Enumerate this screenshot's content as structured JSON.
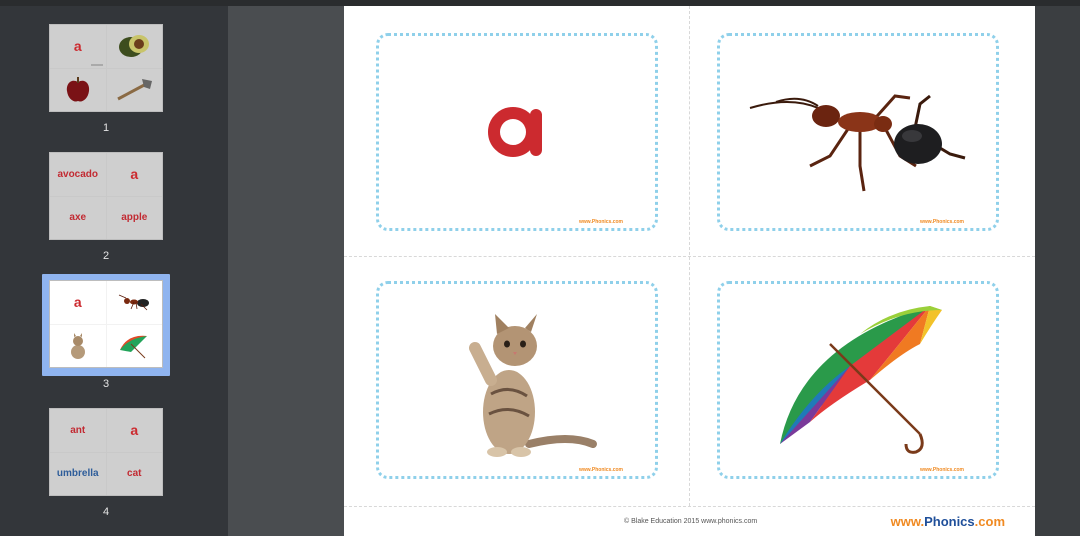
{
  "thumbnails": [
    {
      "number": "1",
      "cells": [
        {
          "kind": "letter",
          "text": "a"
        },
        {
          "kind": "icon",
          "text": "avocado"
        },
        {
          "kind": "icon",
          "text": "apple"
        },
        {
          "kind": "icon",
          "text": "axe"
        }
      ]
    },
    {
      "number": "2",
      "cells": [
        {
          "kind": "word",
          "text": "avocado"
        },
        {
          "kind": "letter",
          "text": "a"
        },
        {
          "kind": "word",
          "text": "axe"
        },
        {
          "kind": "word",
          "text": "apple"
        }
      ]
    },
    {
      "number": "3",
      "selected": true,
      "cells": [
        {
          "kind": "letter",
          "text": "a"
        },
        {
          "kind": "icon",
          "text": "ant"
        },
        {
          "kind": "icon",
          "text": "cat"
        },
        {
          "kind": "icon",
          "text": "umbrella"
        }
      ]
    },
    {
      "number": "4",
      "cells": [
        {
          "kind": "word",
          "text": "ant"
        },
        {
          "kind": "letter",
          "text": "a"
        },
        {
          "kind": "word",
          "text": "umbrella"
        },
        {
          "kind": "word",
          "text": "cat"
        }
      ]
    }
  ],
  "page": {
    "cards": [
      {
        "id": "letter-a",
        "letter": "a",
        "footer": "www.Phonics.com"
      },
      {
        "id": "ant",
        "image": "ant",
        "footer": "www.Phonics.com"
      },
      {
        "id": "cat",
        "image": "kitten",
        "footer": "www.Phonics.com"
      },
      {
        "id": "umbrella",
        "image": "umbrella",
        "footer": "www.Phonics.com"
      }
    ],
    "copyright": "© Blake Education 2015  www.phonics.com",
    "brand_prefix": "www.",
    "brand_main": "Phonics",
    "brand_suffix": ".com"
  },
  "colors": {
    "letter_red": "#cc2a2f",
    "brand_orange": "#f08a22",
    "brand_blue": "#1f4f9a",
    "card_border": "#8fd0ea",
    "selection": "#8fb4ef"
  }
}
